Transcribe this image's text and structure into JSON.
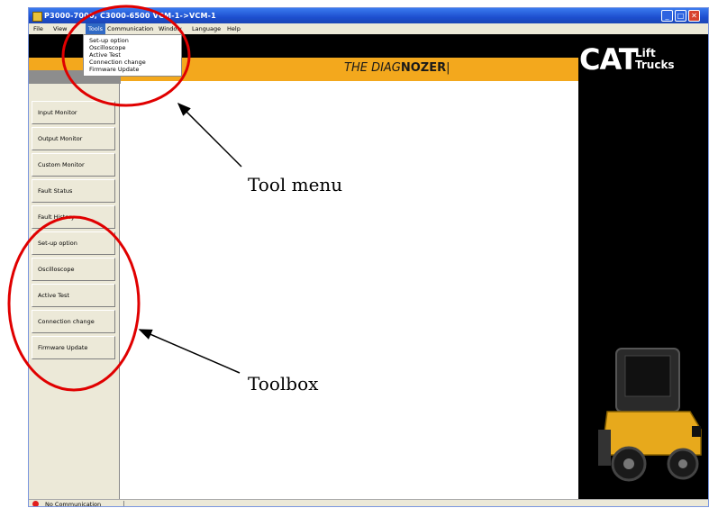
{
  "window": {
    "title": "P3000-7000, C3000-6500 VCM-1->VCM-1",
    "controls": {
      "minimize": "_",
      "maximize": "□",
      "close": "✕"
    }
  },
  "menubar": {
    "items": [
      "File",
      "View",
      "Tools",
      "Communication",
      "Window",
      "Language",
      "Help"
    ],
    "active": "Tools"
  },
  "tools_menu": {
    "items": [
      "Set-up option",
      "Oscilloscope",
      "Active Test",
      "Connection change",
      "Firmware Update"
    ]
  },
  "banner": {
    "brand_prefix": "THE DIAG",
    "brand_bold": "NOZER",
    "logo_text": "CAT",
    "logo_subtitle_1": "Lift",
    "logo_subtitle_2": "Trucks"
  },
  "toolbox": {
    "buttons": [
      "Input Monitor",
      "Output Monitor",
      "Custom Monitor",
      "Fault Status",
      "Fault History",
      "Set-up option",
      "Oscilloscope",
      "Active Test",
      "Connection change",
      "Firmware Update"
    ]
  },
  "status": {
    "text": "No Communication"
  },
  "annotations": {
    "tool_menu": "Tool menu",
    "toolbox": "Toolbox"
  },
  "colors": {
    "title_bar": "#1d4fcf",
    "banner_orange": "#f3a81d",
    "annotation_red": "#e00000",
    "close_button": "#d8442e"
  }
}
